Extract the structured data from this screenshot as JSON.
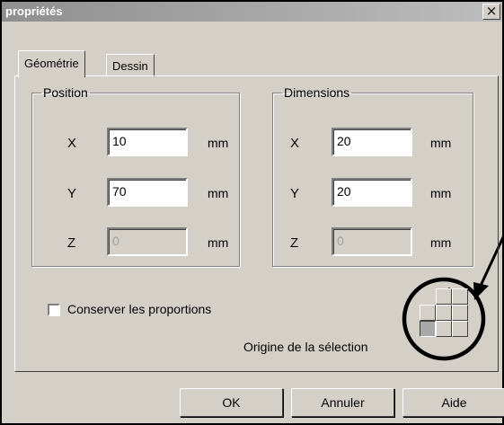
{
  "window": {
    "title": "propriétés",
    "close_symbol": "×"
  },
  "tabs": [
    {
      "label": "Géométrie",
      "active": true
    },
    {
      "label": "Dessin",
      "active": false
    }
  ],
  "position": {
    "legend": "Position",
    "x": {
      "label": "X",
      "value": "10",
      "unit": "mm"
    },
    "y": {
      "label": "Y",
      "value": "70",
      "unit": "mm"
    },
    "z": {
      "label": "Z",
      "value": "0",
      "unit": "mm",
      "disabled": true
    }
  },
  "dimensions": {
    "legend": "Dimensions",
    "x": {
      "label": "X",
      "value": "20",
      "unit": "mm"
    },
    "y": {
      "label": "Y",
      "value": "20",
      "unit": "mm"
    },
    "z": {
      "label": "Z",
      "value": "0",
      "unit": "mm",
      "disabled": true
    }
  },
  "keep_proportions": {
    "label": "Conserver les proportions",
    "checked": false
  },
  "origin": {
    "label": "Origine de la sélection",
    "selected_cell": "bottom-left"
  },
  "buttons": {
    "ok": "OK",
    "cancel": "Annuler",
    "help": "Aide"
  }
}
